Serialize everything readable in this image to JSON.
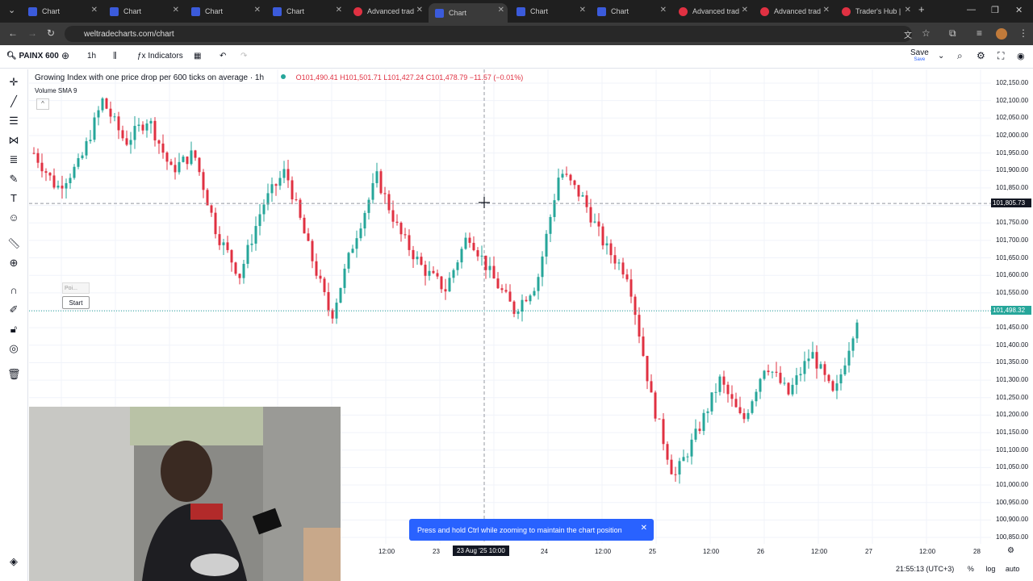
{
  "browser": {
    "tabs": [
      {
        "label": "Chart",
        "icon": "chart-favicon-icon"
      },
      {
        "label": "Chart",
        "icon": "chart-favicon-icon"
      },
      {
        "label": "Chart",
        "icon": "chart-favicon-icon"
      },
      {
        "label": "Chart",
        "icon": "chart-favicon-icon"
      },
      {
        "label": "Advanced trad",
        "icon": "trading-favicon-icon"
      },
      {
        "label": "Chart",
        "icon": "chart-favicon-icon",
        "active": true
      },
      {
        "label": "Chart",
        "icon": "chart-favicon-icon"
      },
      {
        "label": "Chart",
        "icon": "chart-favicon-icon"
      },
      {
        "label": "Advanced trad",
        "icon": "trading-favicon-icon"
      },
      {
        "label": "Advanced trad",
        "icon": "trading-favicon-icon"
      },
      {
        "label": "Trader's Hub |",
        "icon": "trading-favicon-icon"
      }
    ],
    "url": "weltradecharts.com/chart"
  },
  "toolbar": {
    "symbol": "PAINX 600",
    "interval": "1h",
    "indicators_label": "Indicators",
    "save_label": "Save",
    "save_sub": "Save"
  },
  "legend": {
    "title": "Growing Index with one price drop per 600 ticks on average · 1h",
    "ohlc": "O101,490.41 H101,501.71 L101,427.24 C101,478.79 −11.57 (−0.01%)",
    "volume": "Volume SMA 9"
  },
  "overlay": {
    "start_label": "Start",
    "poi_label": "Poi..."
  },
  "axis": {
    "labels": [
      "102,150.00",
      "102,100.00",
      "102,050.00",
      "102,000.00",
      "101,950.00",
      "101,900.00",
      "101,850.00",
      "101,750.00",
      "101,700.00",
      "101,650.00",
      "101,600.00",
      "101,550.00",
      "101,450.00",
      "101,400.00",
      "101,350.00",
      "101,300.00",
      "101,250.00",
      "101,200.00",
      "101,150.00",
      "101,100.00",
      "101,050.00",
      "101,000.00",
      "100,950.00",
      "100,900.00",
      "100,850.00"
    ],
    "crosshair_price": "101,805.73",
    "last_price": "101,498.32"
  },
  "xaxis": {
    "labels": [
      "12:00",
      "23",
      "12:00",
      "24",
      "12:00",
      "25",
      "12:00",
      "26",
      "12:00",
      "27",
      "12:00",
      "28"
    ],
    "crosshair_time": "23 Aug '25  10:00"
  },
  "toast": {
    "text": "Press and hold Ctrl while zooming to maintain the chart position"
  },
  "status": {
    "time": "21:55:13 (UTC+3)",
    "pct": "%",
    "log": "log",
    "auto": "auto"
  },
  "colors": {
    "up": "#26a69a",
    "down": "#e03142",
    "accent": "#2962ff"
  },
  "chart_data": {
    "type": "candlestick",
    "y_range": [
      100850,
      102150
    ],
    "series": [
      {
        "close_path": [
          101950,
          101850,
          101920,
          102100,
          101980,
          102050,
          101900,
          101950,
          101720,
          101600,
          101800,
          101900,
          101680,
          101480,
          101700,
          101880,
          101720,
          101620,
          101560,
          101720,
          101600,
          101500,
          101580,
          101900,
          101820,
          101680,
          101600,
          101250,
          101020,
          101150,
          101300,
          101180,
          101350,
          101260,
          101380,
          101250,
          101480
        ]
      }
    ]
  }
}
